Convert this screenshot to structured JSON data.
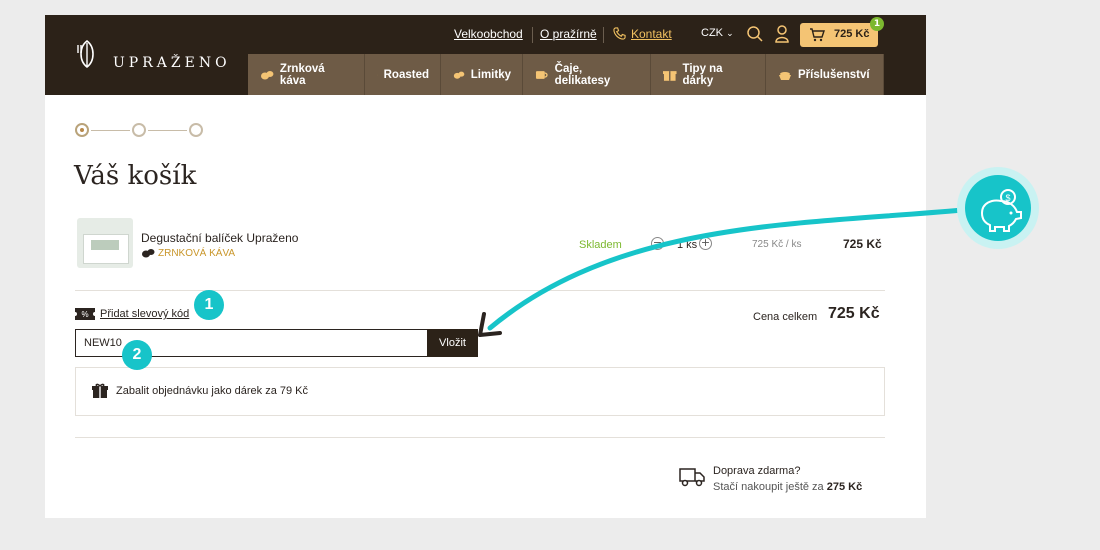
{
  "header": {
    "logo": "UPRAŽENO",
    "top_links": [
      "Velkoobchod",
      "O pražírně",
      "Kontakt"
    ],
    "currency": "CZK",
    "cart_total": "725 Kč",
    "cart_count": "1"
  },
  "nav": {
    "items": [
      {
        "label": "Zrnková káva",
        "icon": "coffee-bean-icon"
      },
      {
        "label": "Roasted",
        "icon": "wheat-icon"
      },
      {
        "label": "Limitky",
        "icon": "coffee-bean-icon"
      },
      {
        "label": "Čaje, delikatesy",
        "icon": "tea-cup-icon"
      },
      {
        "label": "Tipy na dárky",
        "icon": "gift-icon"
      },
      {
        "label": "Příslušenství",
        "icon": "kettle-icon"
      }
    ]
  },
  "cart": {
    "title": "Váš košík",
    "item": {
      "name": "Degustační balíček Upraženo",
      "category": "ZRNKOVÁ KÁVA",
      "stock": "Skladem",
      "qty": "1 ks",
      "unit_price": "725 Kč / ks",
      "total": "725 Kč"
    },
    "discount_link": "Přidat slevový kód",
    "code_value": "NEW10",
    "code_button": "Vložit",
    "total_label": "Cena celkem",
    "total_value": "725 Kč",
    "gift_wrap": "Zabalit objednávku jako dárek za 79 Kč",
    "shipping_title": "Doprava zdarma?",
    "shipping_sub_prefix": "Stačí nakoupit ještě za",
    "shipping_amount": "275 Kč"
  },
  "annotations": {
    "marker1": "1",
    "marker2": "2"
  },
  "colors": {
    "header_bg": "#2c2218",
    "nav_bg": "#6e5b46",
    "accent_cyan": "#17c4c9",
    "cart_bg": "#f4c474",
    "stock_green": "#7cb82f"
  }
}
